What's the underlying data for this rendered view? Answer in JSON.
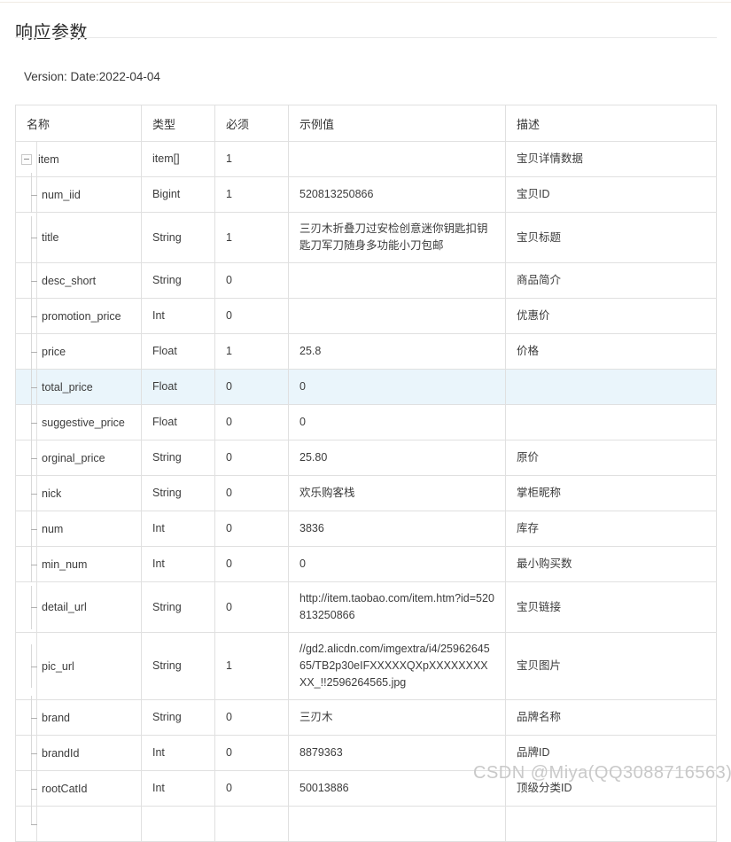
{
  "page": {
    "title": "响应参数",
    "version_line": "Version: Date:2022-04-04",
    "watermark": "CSDN @Miya(QQ3088716563)"
  },
  "colors": {
    "title_rule": "#e8e8e8",
    "table_border": "#e0e0e0",
    "row_highlight": "#eaf5fb",
    "watermark": "#c9c9c9",
    "text": "#3c3c3c"
  },
  "table": {
    "headers": [
      "名称",
      "类型",
      "必须",
      "示例值",
      "描述"
    ],
    "rows": [
      {
        "level": 0,
        "toggle": "collapse-box",
        "name": "item",
        "type": "item[]",
        "required": "1",
        "sample": "",
        "desc": "宝贝详情数据",
        "highlight": false
      },
      {
        "level": 1,
        "name": "num_iid",
        "type": "Bigint",
        "required": "1",
        "sample": "520813250866",
        "desc": "宝贝ID",
        "highlight": false
      },
      {
        "level": 1,
        "name": "title",
        "type": "String",
        "required": "1",
        "sample": "三刃木折叠刀过安检创意迷你钥匙扣钥匙刀军刀随身多功能小刀包邮",
        "desc": "宝贝标题",
        "highlight": false
      },
      {
        "level": 1,
        "name": "desc_short",
        "type": "String",
        "required": "0",
        "sample": "",
        "desc": "商品简介",
        "highlight": false
      },
      {
        "level": 1,
        "name": "promotion_price",
        "type": "Int",
        "required": "0",
        "sample": "",
        "desc": "优惠价",
        "highlight": false
      },
      {
        "level": 1,
        "name": "price",
        "type": "Float",
        "required": "1",
        "sample": "25.8",
        "desc": "价格",
        "highlight": false
      },
      {
        "level": 1,
        "name": "total_price",
        "type": "Float",
        "required": "0",
        "sample": "0",
        "desc": "",
        "highlight": true
      },
      {
        "level": 1,
        "name": "suggestive_price",
        "type": "Float",
        "required": "0",
        "sample": "0",
        "desc": "",
        "highlight": false
      },
      {
        "level": 1,
        "name": "orginal_price",
        "type": "String",
        "required": "0",
        "sample": "25.80",
        "desc": "原价",
        "highlight": false
      },
      {
        "level": 1,
        "name": "nick",
        "type": "String",
        "required": "0",
        "sample": "欢乐购客栈",
        "desc": "掌柜昵称",
        "highlight": false
      },
      {
        "level": 1,
        "name": "num",
        "type": "Int",
        "required": "0",
        "sample": "3836",
        "desc": "库存",
        "highlight": false
      },
      {
        "level": 1,
        "name": "min_num",
        "type": "Int",
        "required": "0",
        "sample": "0",
        "desc": "最小购买数",
        "highlight": false
      },
      {
        "level": 1,
        "name": "detail_url",
        "type": "String",
        "required": "0",
        "sample": "http://item.taobao.com/item.htm?id=520813250866",
        "desc": "宝贝链接",
        "highlight": false
      },
      {
        "level": 1,
        "name": "pic_url",
        "type": "String",
        "required": "1",
        "sample": "//gd2.alicdn.com/imgextra/i4/2596264565/TB2p30eIFXXXXXQXpXXXXXXXXXX_!!2596264565.jpg",
        "desc": "宝贝图片",
        "highlight": false
      },
      {
        "level": 1,
        "name": "brand",
        "type": "String",
        "required": "0",
        "sample": "三刃木",
        "desc": "品牌名称",
        "highlight": false
      },
      {
        "level": 1,
        "name": "brandId",
        "type": "Int",
        "required": "0",
        "sample": "8879363",
        "desc": "品牌ID",
        "highlight": false
      },
      {
        "level": 1,
        "name": "rootCatId",
        "type": "Int",
        "required": "0",
        "sample": "50013886",
        "desc": "顶级分类ID",
        "highlight": false
      },
      {
        "level": 1,
        "name": "",
        "type": "",
        "required": "",
        "sample": "",
        "desc": "",
        "highlight": false
      }
    ]
  }
}
